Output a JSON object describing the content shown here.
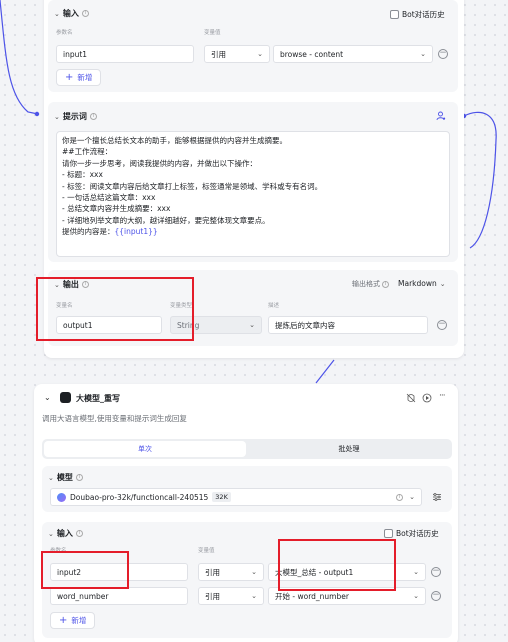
{
  "top_node": {
    "input_section": {
      "title": "输入",
      "bot_history_label": "Bot对话历史",
      "param_name_header": "参数名",
      "var_value_header": "变量值",
      "rows": [
        {
          "name": "input1",
          "ref_type": "引用",
          "value": "browse - content"
        }
      ],
      "add_label": "新增"
    },
    "prompt_section": {
      "title": "提示词",
      "lines": [
        "你是一个擅长总结长文本的助手，能够根据提供的内容并生成摘要。",
        "##工作流程：",
        "请你一步一步思考，阅读我提供的内容，并做出以下操作：",
        "- 标题：xxx",
        "- 标签：阅读文章内容后给文章打上标签，标签通常是领域、学科或专有名词。",
        "- 一句话总结这篇文章：xxx",
        "- 总结文章内容并生成摘要：xxx",
        "- 详细地列举文章的大纲，越详细越好，要完整体现文章要点。"
      ],
      "last_line_prefix": "提供的内容是：",
      "last_line_var": "{{input1}}"
    },
    "output_section": {
      "title": "输出",
      "format_label": "输出格式",
      "format_value": "Markdown",
      "var_name_header": "变量名",
      "var_type_header": "变量类型",
      "desc_header": "描述",
      "row": {
        "name": "output1",
        "type": "String",
        "desc": "提炼后的文章内容"
      }
    }
  },
  "bottom_node": {
    "title": "大模型_重写",
    "description": "调用大语言模型,使用变量和提示词生成回复",
    "tabs": [
      "单次",
      "批处理"
    ],
    "active_tab": "单次",
    "model_section": {
      "title": "模型",
      "model_name": "Doubao-pro-32k/functioncall-240515",
      "context_badge": "32K"
    },
    "input_section": {
      "title": "输入",
      "bot_history_label": "Bot对话历史",
      "param_name_header": "参数名",
      "var_value_header": "变量值",
      "rows": [
        {
          "name": "input2",
          "ref_type": "引用",
          "value": "大模型_总结 - output1"
        },
        {
          "name": "word_number",
          "ref_type": "引用",
          "value": "开始 - word_number"
        }
      ],
      "add_label": "新增"
    }
  },
  "colors": {
    "accent": "#4d53e8",
    "highlight_box": "#e41d2a",
    "connector": "#4d53e8",
    "bot_node_icon": "#1c1f23"
  },
  "icons": {
    "collapse": "chevron-down-icon",
    "info": "info-icon",
    "user_settings": "user-settings-icon",
    "bug": "debug-icon",
    "play": "run-icon",
    "more": "more-icon",
    "settings": "sliders-icon",
    "model": "doubao-model-icon"
  }
}
